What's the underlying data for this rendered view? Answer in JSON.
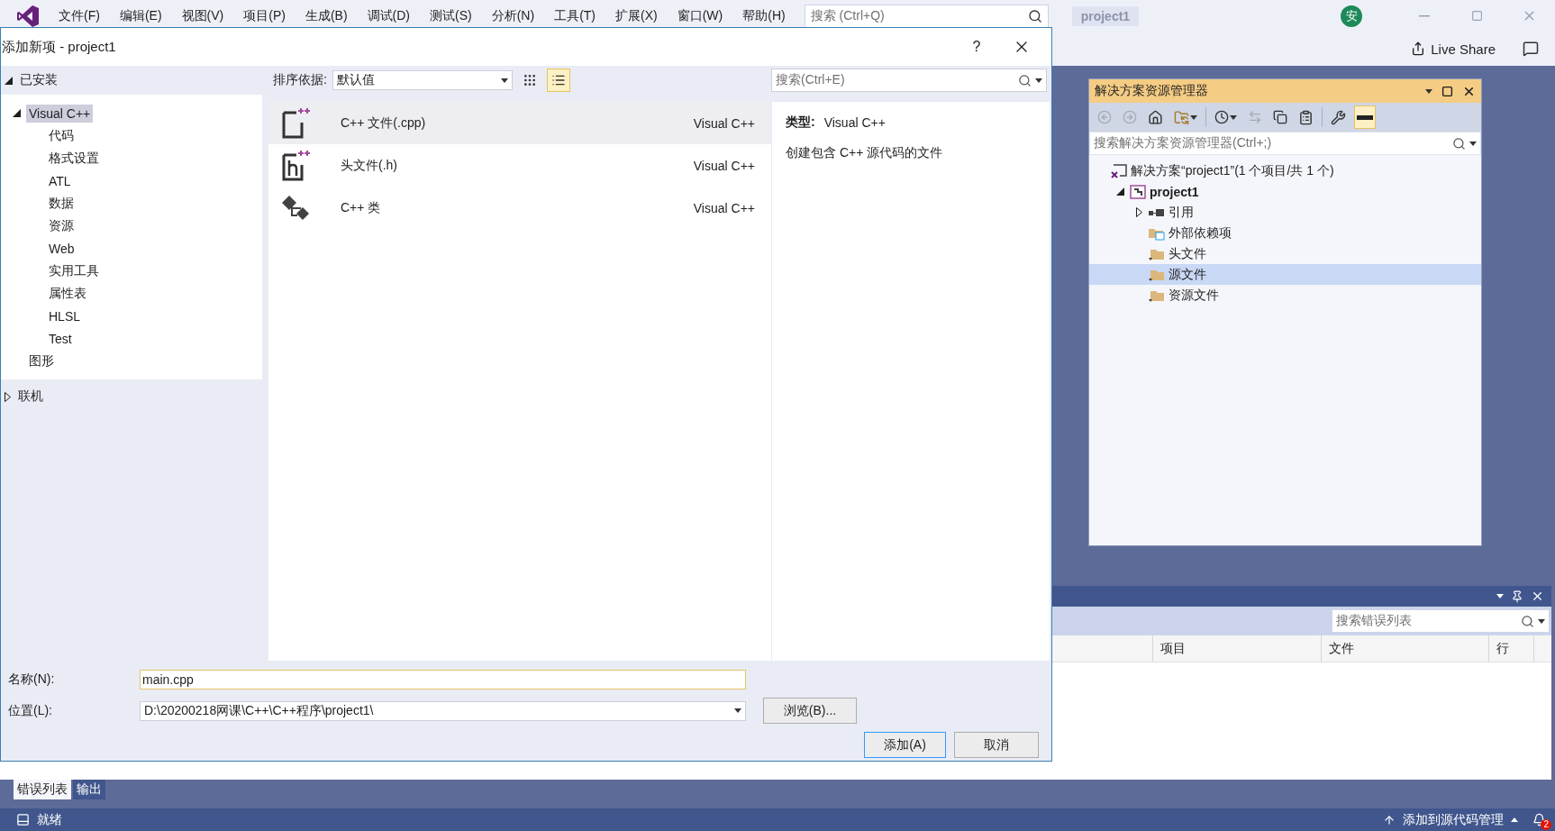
{
  "menu_bar": {
    "items": [
      "文件(F)",
      "编辑(E)",
      "视图(V)",
      "项目(P)",
      "生成(B)",
      "调试(D)",
      "测试(S)",
      "分析(N)",
      "工具(T)",
      "扩展(X)",
      "窗口(W)",
      "帮助(H)"
    ],
    "search": {
      "placeholder": "搜索 (Ctrl+Q)"
    },
    "solution_name": "project1",
    "avatar": "安"
  },
  "live_share": "Live Share",
  "dialog": {
    "title": "添加新项 - project1",
    "help": "?",
    "installed": {
      "label": "已安装",
      "expanded": true
    },
    "tree": [
      {
        "label": "Visual C++",
        "expanded": true,
        "selected": true,
        "children": [
          {
            "label": "代码",
            "selected": false
          },
          {
            "label": "格式设置",
            "selected": false
          },
          {
            "label": "ATL",
            "selected": false
          },
          {
            "label": "数据",
            "selected": false
          },
          {
            "label": "资源",
            "selected": false
          },
          {
            "label": "Web",
            "selected": false
          },
          {
            "label": "实用工具",
            "selected": false
          },
          {
            "label": "属性表",
            "selected": false
          },
          {
            "label": "HLSL",
            "selected": false
          },
          {
            "label": "Test",
            "selected": false
          }
        ]
      },
      {
        "label": "图形",
        "selected": false
      }
    ],
    "online": {
      "label": "联机",
      "expanded": false
    },
    "sort_label": "排序依据:",
    "sort_value": "默认值",
    "views": [
      {
        "kind": "grid",
        "selected": false
      },
      {
        "kind": "list",
        "selected": true
      }
    ],
    "search": {
      "placeholder": "搜索(Ctrl+E)"
    },
    "templates": [
      {
        "kind": "cpp",
        "name": "C++ 文件(.cpp)",
        "type": "Visual C++",
        "selected": true
      },
      {
        "kind": "header",
        "name": "头文件(.h)",
        "type": "Visual C++",
        "selected": false
      },
      {
        "kind": "class",
        "name": "C++ 类",
        "type": "Visual C++",
        "selected": false
      }
    ],
    "details": {
      "type_label": "类型:",
      "type_value": "Visual C++",
      "description": "创建包含 C++ 源代码的文件"
    },
    "name_label": "名称(N):",
    "name_value": "main.cpp",
    "location_label": "位置(L):",
    "location_value": "D:\\20200218网课\\C++\\C++程序\\project1\\",
    "browse": "浏览(B)...",
    "add": "添加(A)",
    "cancel": "取消"
  },
  "solution_explorer": {
    "title": "解决方案资源管理器",
    "search": {
      "placeholder": "搜索解决方案资源管理器(Ctrl+;)"
    },
    "tree": [
      {
        "kind": "solution",
        "label": "解决方案“project1”(1 个项目/共 1 个)",
        "selected": false,
        "children": [
          {
            "kind": "project",
            "label": "project1",
            "expanded": true,
            "selected": false,
            "children": [
              {
                "kind": "references",
                "label": "引用",
                "expanded": false,
                "selected": false
              },
              {
                "kind": "external",
                "label": "外部依赖项",
                "selected": false
              },
              {
                "kind": "folder",
                "label": "头文件",
                "selected": false
              },
              {
                "kind": "folder",
                "label": "源文件",
                "selected": true
              },
              {
                "kind": "folder",
                "label": "资源文件",
                "selected": false
              }
            ]
          }
        ]
      }
    ]
  },
  "error_list": {
    "search": {
      "placeholder": "搜索错误列表"
    },
    "columns": [
      "项目",
      "文件",
      "行"
    ]
  },
  "bottom_tabs": [
    {
      "label": "错误列表",
      "selected": true
    },
    {
      "label": "输出",
      "selected": false
    }
  ],
  "status_bar": {
    "text": "就绪",
    "source_control": "添加到源代码管理",
    "notifications": "2"
  }
}
